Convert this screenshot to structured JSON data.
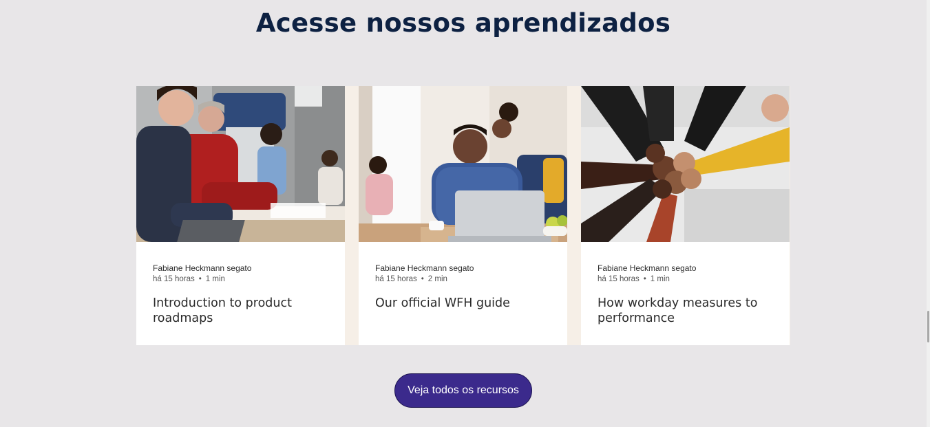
{
  "section": {
    "heading": "Acesse nossos aprendizados"
  },
  "cards": [
    {
      "author": "Fabiane Heckmann segato",
      "time": "há 15 horas",
      "read": "1 min",
      "title": "Introduction to product roadmaps",
      "image": "team-meeting-photo"
    },
    {
      "author": "Fabiane Heckmann segato",
      "time": "há 15 horas",
      "read": "2 min",
      "title": "Our official WFH guide",
      "image": "work-from-home-photo"
    },
    {
      "author": "Fabiane Heckmann segato",
      "time": "há 15 horas",
      "read": "1 min",
      "title": "How workday measures to performance",
      "image": "team-fist-bump-photo"
    }
  ],
  "cta": {
    "label": "Veja todos os recursos"
  },
  "colors": {
    "background": "#e8e6e8",
    "heading": "#0d2142",
    "button": "#3b2a8c",
    "card_gap": "#f6efe7"
  }
}
